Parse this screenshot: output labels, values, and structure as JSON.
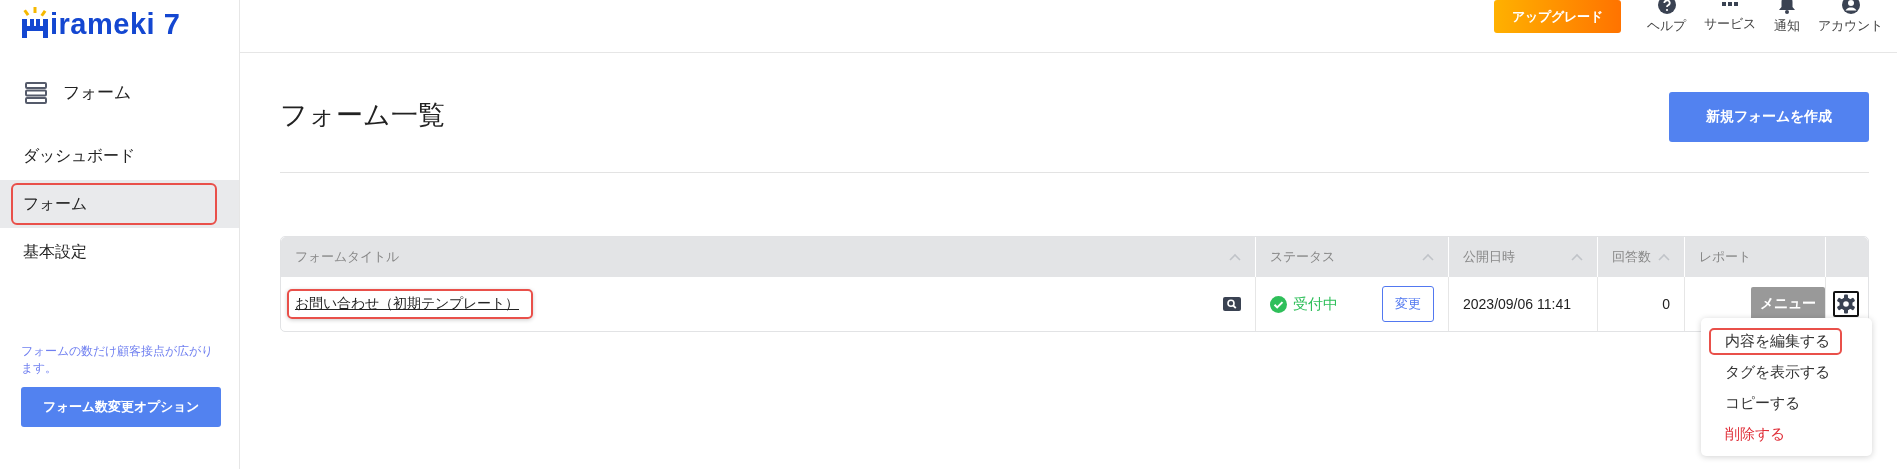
{
  "logo": {
    "text": "irameki 7"
  },
  "header": {
    "upgrade": "アップグレード",
    "icons": [
      {
        "kind": "help",
        "label": "ヘルプ"
      },
      {
        "kind": "services",
        "label": "サービス"
      },
      {
        "kind": "bell",
        "label": "通知"
      },
      {
        "kind": "account",
        "label": "アカウント"
      }
    ]
  },
  "sidebar": {
    "section": "フォーム",
    "items": [
      {
        "label": "ダッシュボード",
        "selected": false,
        "highlighted": false
      },
      {
        "label": "フォーム",
        "selected": true,
        "highlighted": true
      },
      {
        "label": "基本設定",
        "selected": false,
        "highlighted": false
      }
    ],
    "note": "フォームの数だけ顧客接点が広がります。",
    "option_button": "フォーム数変更オプション"
  },
  "page": {
    "title": "フォーム一覧",
    "new_button": "新規フォームを作成"
  },
  "table": {
    "columns": [
      {
        "label": "フォームタイトル",
        "sortable": true
      },
      {
        "label": "ステータス",
        "sortable": true
      },
      {
        "label": "公開日時",
        "sortable": true
      },
      {
        "label": "回答数",
        "sortable": true
      },
      {
        "label": "レポート",
        "sortable": false
      }
    ],
    "rows": [
      {
        "title": "お問い合わせ（初期テンプレート）",
        "highlighted": true,
        "status": "受付中",
        "change": "変更",
        "published": "2023/09/06 11:41",
        "answers": "0",
        "menu": "メニュー"
      }
    ]
  },
  "menu": {
    "items": [
      {
        "label": "内容を編集する",
        "kind": "normal",
        "highlighted": true
      },
      {
        "label": "タグを表示する",
        "kind": "normal",
        "highlighted": false
      },
      {
        "label": "コピーする",
        "kind": "normal",
        "highlighted": false
      },
      {
        "label": "削除する",
        "kind": "danger",
        "highlighted": false
      }
    ]
  }
}
